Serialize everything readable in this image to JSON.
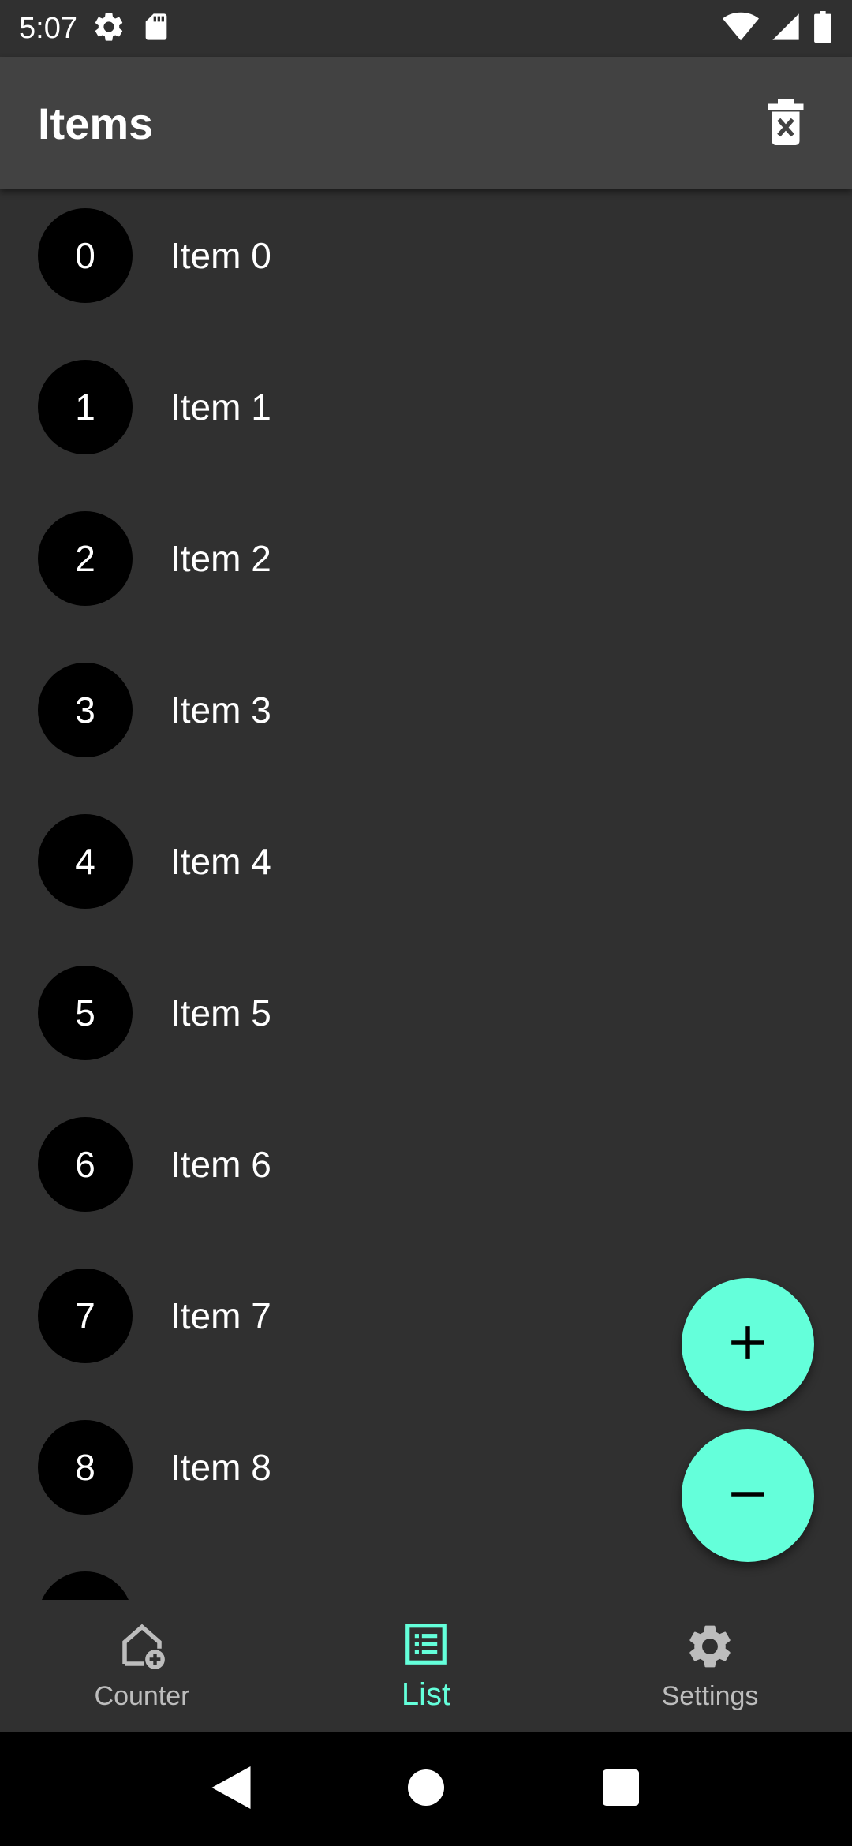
{
  "status_bar": {
    "time": "5:07",
    "left_icons": [
      "settings-gear-icon",
      "sd-card-icon"
    ],
    "right_icons": [
      "wifi-icon",
      "signal-icon",
      "battery-icon"
    ]
  },
  "app_bar": {
    "title": "Items",
    "action_icon": "delete-sweep-icon"
  },
  "list": {
    "items": [
      {
        "number": "0",
        "label": "Item 0"
      },
      {
        "number": "1",
        "label": "Item 1"
      },
      {
        "number": "2",
        "label": "Item 2"
      },
      {
        "number": "3",
        "label": "Item 3"
      },
      {
        "number": "4",
        "label": "Item 4"
      },
      {
        "number": "5",
        "label": "Item 5"
      },
      {
        "number": "6",
        "label": "Item 6"
      },
      {
        "number": "7",
        "label": "Item 7"
      },
      {
        "number": "8",
        "label": "Item 8"
      }
    ]
  },
  "fabs": {
    "add_icon": "plus-icon",
    "remove_icon": "minus-icon"
  },
  "bottom_nav": {
    "items": [
      {
        "label": "Counter",
        "icon": "home-add-icon",
        "active": false
      },
      {
        "label": "List",
        "icon": "list-icon",
        "active": true
      },
      {
        "label": "Settings",
        "icon": "gear-icon",
        "active": false
      }
    ]
  },
  "colors": {
    "background": "#303030",
    "app_bar": "#424242",
    "accent": "#64ffda",
    "avatar": "#000000",
    "text": "#ffffff",
    "inactive": "#bdbdbd"
  }
}
